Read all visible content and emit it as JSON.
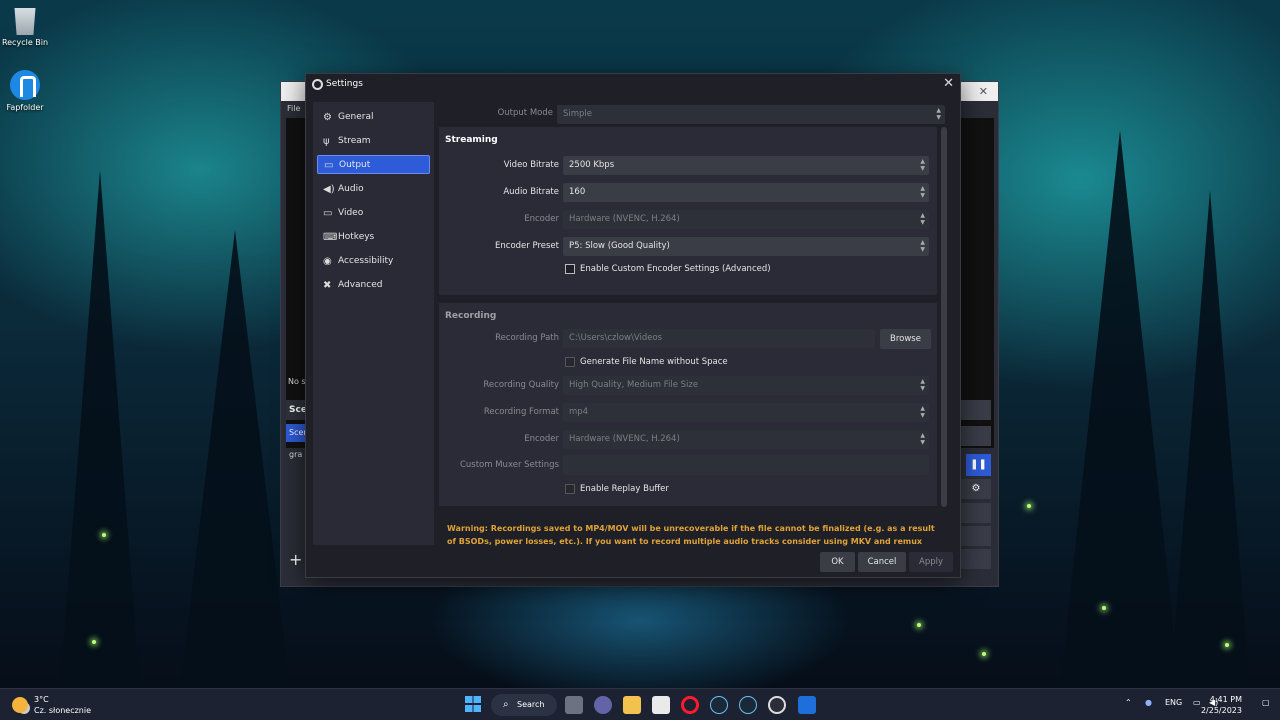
{
  "desktop": {
    "icons": [
      {
        "label": "Recycle Bin",
        "icon": "recycle-bin-icon"
      },
      {
        "label": "Fapfolder",
        "icon": "accessibility-folder-icon"
      }
    ]
  },
  "obs_main": {
    "menu_label": "File",
    "no_source_text": "No s",
    "scenes_header": "Scer",
    "scene_selected": "Scer",
    "scene_item": "gra",
    "add_symbol": "+"
  },
  "settings": {
    "title": "Settings",
    "close_symbol": "✕",
    "sidebar": [
      {
        "label": "General",
        "icon": "gear-icon",
        "glyph": "⚙"
      },
      {
        "label": "Stream",
        "icon": "antenna-icon",
        "glyph": "📶"
      },
      {
        "label": "Output",
        "icon": "monitor-output-icon",
        "glyph": "▭",
        "active": true
      },
      {
        "label": "Audio",
        "icon": "speaker-icon",
        "glyph": "🔊"
      },
      {
        "label": "Video",
        "icon": "monitor-icon",
        "glyph": "▭"
      },
      {
        "label": "Hotkeys",
        "icon": "keyboard-icon",
        "glyph": "⌨"
      },
      {
        "label": "Accessibility",
        "icon": "accessibility-icon",
        "glyph": "◉"
      },
      {
        "label": "Advanced",
        "icon": "tools-icon",
        "glyph": "✖"
      }
    ],
    "output_mode": {
      "label": "Output Mode",
      "value": "Simple"
    },
    "streaming": {
      "title": "Streaming",
      "video_bitrate": {
        "label": "Video Bitrate",
        "value": "2500 Kbps"
      },
      "audio_bitrate": {
        "label": "Audio Bitrate",
        "value": "160"
      },
      "encoder": {
        "label": "Encoder",
        "value": "Hardware (NVENC, H.264)"
      },
      "encoder_preset": {
        "label": "Encoder Preset",
        "value": "P5: Slow (Good Quality)"
      },
      "custom_encoder_label": "Enable Custom Encoder Settings (Advanced)"
    },
    "recording": {
      "title": "Recording",
      "path": {
        "label": "Recording Path",
        "value": "C:\\Users\\czlow\\Videos"
      },
      "browse_label": "Browse",
      "gen_filename_label": "Generate File Name without Space",
      "quality": {
        "label": "Recording Quality",
        "value": "High Quality, Medium File Size"
      },
      "format": {
        "label": "Recording Format",
        "value": "mp4"
      },
      "encoder": {
        "label": "Encoder",
        "value": "Hardware (NVENC, H.264)"
      },
      "muxer": {
        "label": "Custom Muxer Settings",
        "value": ""
      },
      "replay_label": "Enable Replay Buffer"
    },
    "warning": "Warning: Recordings saved to MP4/MOV will be unrecoverable if the file cannot be finalized (e.g. as a result of BSODs, power losses, etc.). If you want to record multiple audio tracks consider using MKV and remux the",
    "buttons": {
      "ok": "OK",
      "cancel": "Cancel",
      "apply": "Apply"
    },
    "accent_color": "#2e5bd8",
    "warning_color": "#e0a336"
  },
  "taskbar": {
    "weather_temp": "3°C",
    "weather_desc": "Cz. słonecznie",
    "search_label": "Search",
    "language": "ENG",
    "time": "4:41 PM",
    "date": "2/25/2023",
    "apps": [
      {
        "icon": "file-explorer-dark-icon"
      },
      {
        "icon": "teams-chat-icon"
      },
      {
        "icon": "folder-icon"
      },
      {
        "icon": "store-icon"
      },
      {
        "icon": "opera-icon"
      },
      {
        "icon": "steam-icon"
      },
      {
        "icon": "steam-alt-icon"
      },
      {
        "icon": "obs-icon"
      },
      {
        "icon": "app-blue-icon"
      }
    ]
  }
}
